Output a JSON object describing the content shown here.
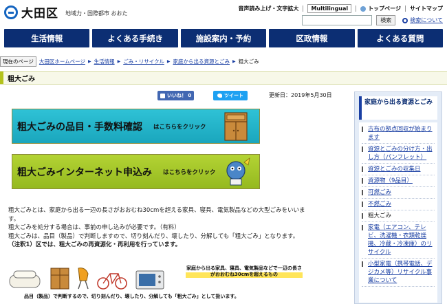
{
  "header": {
    "site_name": "大田区",
    "tagline": "地域力・国際都市 おおた",
    "utility": {
      "read_aloud": "音声読み上げ・文字拡大",
      "multilingual": "Multilingual",
      "top_page": "トップページ",
      "sitemap": "サイトマップ"
    },
    "search": {
      "value": "",
      "button_label": "検索",
      "help_label": "検索について"
    }
  },
  "nav": {
    "items": [
      "生活情報",
      "よくある手続き",
      "施設案内・予約",
      "区政情報",
      "よくある質問"
    ]
  },
  "breadcrumb": {
    "current_label": "現在のページ",
    "items": [
      "大田区ホームページ",
      "生活情報",
      "ごみ・リサイクル",
      "家庭から出る資源とごみ",
      "粗大ごみ"
    ]
  },
  "page": {
    "title": "粗大ごみ",
    "like_label": "いいね！ 0",
    "tweet_label": "ツイート",
    "updated": "更新日：2019年5月30日"
  },
  "banners": [
    {
      "title": "粗大ごみの品目・手数料確認",
      "click": "はこちらをクリック"
    },
    {
      "title": "粗大ごみインターネット申込み",
      "click": "はこちらをクリック"
    }
  ],
  "body": {
    "lines": [
      "粗大ごみとは、家庭から出る一辺の長さがおおむね30cmを超える家具、寝具、電気製品などの大型ごみをいいま",
      "す。",
      "粗大ごみを処分する場合は、事前の申し込みが必要です。（有料）",
      "粗大ごみは、品目（製品）で判断しますので、切り刻んだり、壊したり、分解しても「粗大ごみ」となります。"
    ],
    "note": "（注釈1）区では、粗大ごみの再資源化・再利用を行っています。"
  },
  "illustration": {
    "highlight_text": "家庭から出る家具、寝具、電気製品などで一辺の長さがおおむね30cmを超えるもの",
    "caption": "品目（製品）で判断するので、切り刻んだり、壊したり、分解しても「粗大ごみ」として扱います。"
  },
  "sidebar": {
    "heading": "家庭から出る資源とごみ",
    "items": [
      {
        "label": "古布の拠点回収が始まります",
        "link": true
      },
      {
        "label": "資源とごみの分け方・出し方（パンフレット）",
        "link": true
      },
      {
        "label": "資源とごみの収集日",
        "link": true
      },
      {
        "label": "資源物（9品目）",
        "link": true
      },
      {
        "label": "可燃ごみ",
        "link": true
      },
      {
        "label": "不燃ごみ",
        "link": true
      },
      {
        "label": "粗大ごみ",
        "link": false
      },
      {
        "label": "家電（エアコン、テレビ、洗濯機・衣類乾燥機、冷蔵・冷凍庫）のリサイクル",
        "link": true
      },
      {
        "label": "小型家電（携帯電話、デジカメ等）リサイクル事業について",
        "link": true
      }
    ]
  },
  "colors": {
    "nav": "#0c2e73",
    "banner1": "#1aa6bd",
    "banner2": "#95b91f",
    "title_bar_accent": "#b3c21b",
    "link": "#1a3fa3"
  }
}
